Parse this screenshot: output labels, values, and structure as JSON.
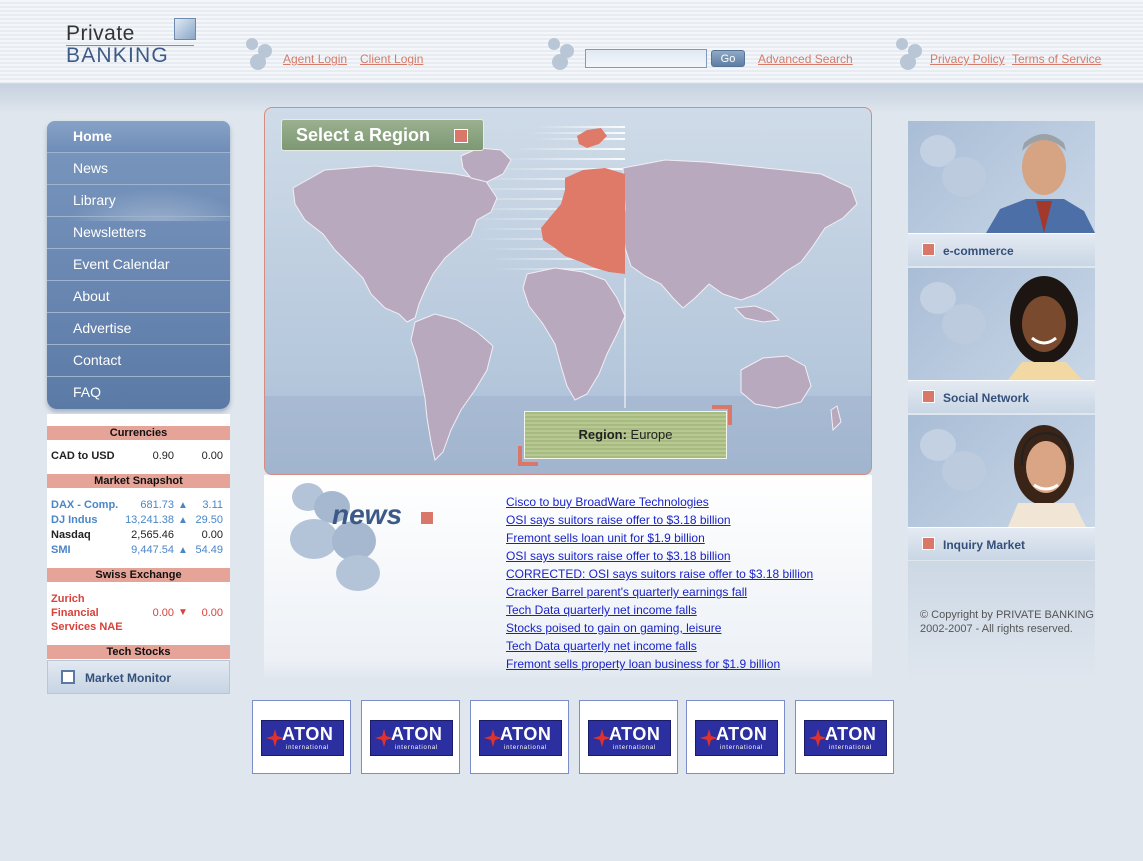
{
  "logo": {
    "line1": "Private",
    "line2": "BANKING"
  },
  "header": {
    "agent_login": "Agent Login",
    "client_login": "Client Login",
    "search_value": "",
    "go_label": "Go",
    "advanced_search": "Advanced Search",
    "privacy_policy": "Privacy Policy",
    "terms_of_service": "Terms of Service"
  },
  "nav": {
    "items": [
      {
        "label": "Home"
      },
      {
        "label": "News"
      },
      {
        "label": "Library"
      },
      {
        "label": "Newsletters"
      },
      {
        "label": "Event  Calendar"
      },
      {
        "label": "About"
      },
      {
        "label": "Advertise"
      },
      {
        "label": "Contact"
      },
      {
        "label": "FAQ"
      }
    ]
  },
  "currencies": {
    "heading": "Currencies",
    "rows": [
      {
        "name": "CAD to USD",
        "value": "0.90",
        "change": "0.00"
      }
    ]
  },
  "market_snapshot": {
    "heading": "Market Snapshot",
    "rows": [
      {
        "name": "DAX - Comp.",
        "value": "681.73",
        "arrow": "▲",
        "change": "3.11"
      },
      {
        "name": "DJ Indus",
        "value": "13,241.38",
        "arrow": "▲",
        "change": "29.50"
      },
      {
        "name": "Nasdaq",
        "value": "2,565.46",
        "arrow": "",
        "change": "0.00"
      },
      {
        "name": "SMI",
        "value": "9,447.54",
        "arrow": "▲",
        "change": "54.49"
      }
    ]
  },
  "swiss_exchange": {
    "heading": "Swiss Exchange",
    "name_line1": "Zurich",
    "name_line2": "Financial",
    "name_line3": "Services NAE",
    "value": "0.00",
    "arrow": "▼",
    "change": "0.00"
  },
  "tech_stocks": {
    "heading": "Tech Stocks",
    "market_monitor": "Market Monitor"
  },
  "map": {
    "select_region": "Select a Region",
    "region_label": "Region:",
    "region_value": "Europe",
    "highlight_color": "#e07a68"
  },
  "news": {
    "title": "news",
    "items": [
      "Cisco to buy BroadWare Technologies",
      "OSI says suitors raise offer to $3.18 billion",
      "Fremont sells loan unit for $1.9 billion",
      "OSI says suitors raise offer to $3.18 billion",
      "CORRECTED: OSI says suitors raise offer to $3.18 billion",
      "Cracker Barrel parent's quarterly earnings fall",
      "Tech Data quarterly net income falls",
      "Stocks poised to gain on gaming, leisure",
      "Tech Data quarterly net income falls",
      "Fremont sells property loan business for $1.9 billion"
    ]
  },
  "promos": [
    {
      "label": "e-commerce"
    },
    {
      "label": "Social Network"
    },
    {
      "label": "Inquiry Market"
    }
  ],
  "copyright": {
    "line1": "© Copyright by PRIVATE BANKING",
    "line2": "2002-2007 - All rights reserved."
  },
  "sponsors": [
    {
      "name": "ATON",
      "sub": "international"
    },
    {
      "name": "ATON",
      "sub": "international"
    },
    {
      "name": "ATON",
      "sub": "international"
    },
    {
      "name": "ATON",
      "sub": "international"
    },
    {
      "name": "ATON",
      "sub": "international"
    },
    {
      "name": "ATON",
      "sub": "international"
    }
  ]
}
